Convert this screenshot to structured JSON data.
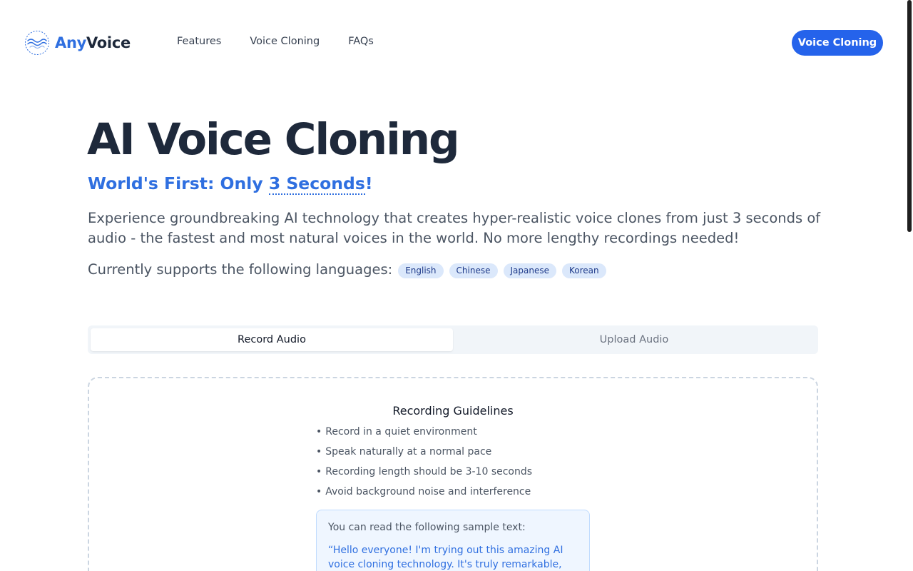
{
  "header": {
    "logo": {
      "part1": "Any",
      "part2": "Voice",
      "icon": "wave-circle-icon"
    },
    "nav": [
      {
        "label": "Features"
      },
      {
        "label": "Voice Cloning"
      },
      {
        "label": "FAQs"
      }
    ],
    "cta_label": "Voice Cloning"
  },
  "hero": {
    "title": "AI Voice Cloning",
    "subtitle_prefix": "World's First: Only ",
    "subtitle_highlight": "3 Seconds",
    "subtitle_suffix": "!",
    "description": "Experience groundbreaking AI technology that creates hyper-realistic voice clones from just 3 seconds of audio - the fastest and most natural voices in the world. No more lengthy recordings needed!",
    "languages_label": "Currently supports the following languages:",
    "languages": [
      "English",
      "Chinese",
      "Japanese",
      "Korean"
    ]
  },
  "tabs": {
    "record": "Record Audio",
    "upload": "Upload Audio",
    "active": "record"
  },
  "guidelines": {
    "title": "Recording Guidelines",
    "items": [
      "Record in a quiet environment",
      "Speak naturally at a normal pace",
      "Recording length should be 3-10 seconds",
      "Avoid background noise and interference"
    ]
  },
  "sample": {
    "label": "You can read the following sample text:",
    "text": "“Hello everyone! I'm trying out this amazing AI voice cloning technology. It's truly remarkable, let's"
  },
  "colors": {
    "brand_blue": "#2f6fe0",
    "cta_blue": "#2563eb",
    "title_dark": "#1e293b",
    "badge_bg": "#dbe8fb"
  }
}
